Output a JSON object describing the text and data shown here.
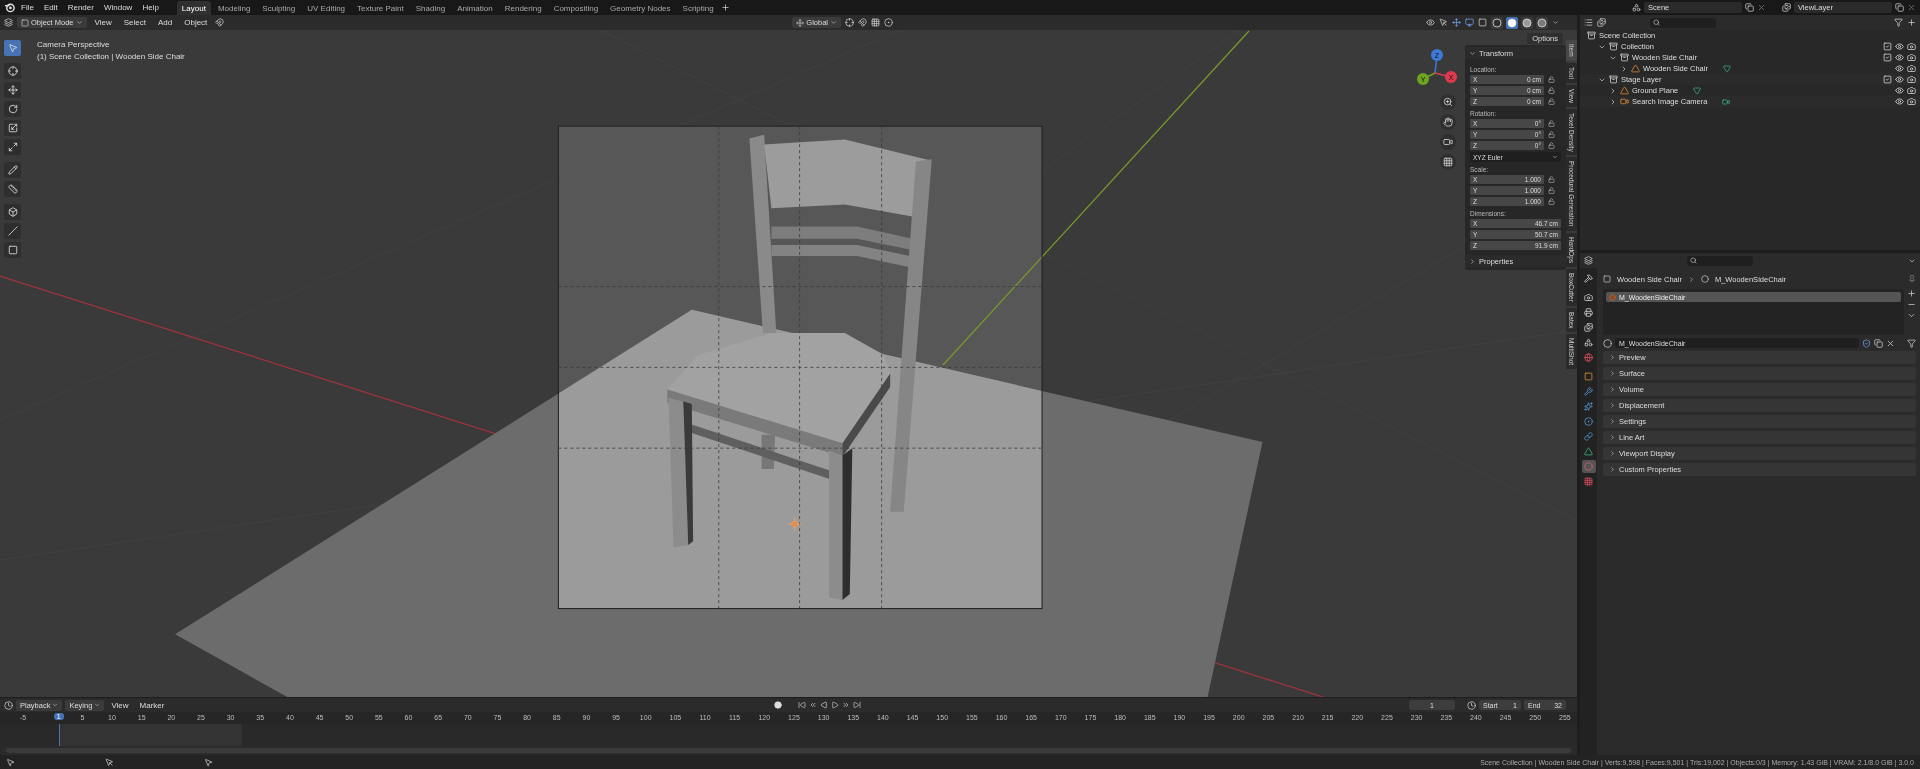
{
  "top_bar": {
    "menus": [
      "File",
      "Edit",
      "Render",
      "Window",
      "Help"
    ],
    "workspaces": [
      {
        "label": "Layout",
        "selected": true
      },
      {
        "label": "Modeling",
        "selected": false
      },
      {
        "label": "Sculpting",
        "selected": false
      },
      {
        "label": "UV Editing",
        "selected": false
      },
      {
        "label": "Texture Paint",
        "selected": false
      },
      {
        "label": "Shading",
        "selected": false
      },
      {
        "label": "Animation",
        "selected": false
      },
      {
        "label": "Rendering",
        "selected": false
      },
      {
        "label": "Compositing",
        "selected": false
      },
      {
        "label": "Geometry Nodes",
        "selected": false
      },
      {
        "label": "Scripting",
        "selected": false
      }
    ],
    "scene": "Scene",
    "view_layer": "ViewLayer"
  },
  "viewport": {
    "mode": "Object Mode",
    "menus": [
      "View",
      "Select",
      "Add",
      "Object"
    ],
    "orientation": "Global",
    "options": "Options",
    "view_name": "Camera Perspective",
    "view_info": "(1) Scene Collection | Wooden Side Chair",
    "tools": [
      {
        "kind": "select",
        "selected": true
      },
      {
        "kind": "cursor",
        "selected": false
      },
      {
        "kind": "move",
        "selected": false
      },
      {
        "kind": "rotate",
        "selected": false
      },
      {
        "kind": "scale",
        "selected": false
      },
      {
        "kind": "transform",
        "selected": false
      },
      {
        "kind": "annotate",
        "selected": false
      },
      {
        "kind": "measure",
        "selected": false
      },
      {
        "kind": "add-cube",
        "selected": false
      },
      {
        "kind": "shear",
        "selected": false
      },
      {
        "kind": "cage",
        "selected": false
      }
    ],
    "gizmo_axes": [
      {
        "label": "Z",
        "color": "#3c7ad6"
      },
      {
        "label": "Y",
        "color": "#6ea51f"
      },
      {
        "label": "X",
        "color": "#e0394f"
      }
    ],
    "shading_modes": [
      {
        "kind": "wireframe",
        "selected": false
      },
      {
        "kind": "solid",
        "selected": true
      },
      {
        "kind": "material",
        "selected": false
      },
      {
        "kind": "rendered",
        "selected": false
      }
    ]
  },
  "sidebar": {
    "tabs": [
      {
        "label": "Item",
        "selected": true
      },
      {
        "label": "Tool",
        "selected": false
      },
      {
        "label": "View",
        "selected": false
      },
      {
        "label": "Texel Density",
        "selected": false
      },
      {
        "label": "Procedural Generation",
        "selected": false
      },
      {
        "label": "HardOps",
        "selected": false
      },
      {
        "label": "BoxCutter",
        "selected": false
      },
      {
        "label": "Batex",
        "selected": false
      },
      {
        "label": "MultiShot",
        "selected": false
      }
    ],
    "transform": {
      "title": "Transform",
      "expanded": true,
      "groups": [
        {
          "kind": "vector",
          "label": "Location:",
          "locks": true,
          "fields": [
            {
              "axis": "X",
              "value": "0 cm"
            },
            {
              "axis": "Y",
              "value": "0 cm"
            },
            {
              "axis": "Z",
              "value": "0 cm"
            }
          ]
        },
        {
          "kind": "vector",
          "label": "Rotation:",
          "locks": true,
          "fields": [
            {
              "axis": "X",
              "value": "0°"
            },
            {
              "axis": "Y",
              "value": "0°"
            },
            {
              "axis": "Z",
              "value": "0°"
            }
          ]
        },
        {
          "kind": "dropdown",
          "value": "XYZ Euler"
        },
        {
          "kind": "vector",
          "label": "Scale:",
          "locks": true,
          "fields": [
            {
              "axis": "X",
              "value": "1.000"
            },
            {
              "axis": "Y",
              "value": "1.000"
            },
            {
              "axis": "Z",
              "value": "1.000"
            }
          ]
        },
        {
          "kind": "vector",
          "label": "Dimensions:",
          "locks": false,
          "fields": [
            {
              "axis": "X",
              "value": "46.7 cm"
            },
            {
              "axis": "Y",
              "value": "50.7 cm"
            },
            {
              "axis": "Z",
              "value": "91.9 cm"
            }
          ]
        }
      ]
    },
    "properties_panel": {
      "title": "Properties",
      "expanded": false
    }
  },
  "outliner": {
    "items": [
      {
        "label": "Scene Collection",
        "kind": "scene-collection",
        "children": [
          {
            "label": "Collection",
            "kind": "collection",
            "expanded": true,
            "children": [
              {
                "label": "Wooden Side Chair",
                "kind": "collection",
                "expanded": true,
                "children": [
                  {
                    "label": "Wooden Side Chair",
                    "kind": "mesh",
                    "data_block": {
                      "kind": "mesh"
                    },
                    "expanded": false
                  }
                ]
              }
            ]
          },
          {
            "label": "Stage Layer",
            "kind": "collection",
            "expanded": true,
            "children": [
              {
                "label": "Ground Plane",
                "kind": "mesh",
                "data_block": {
                  "kind": "mesh"
                },
                "expanded": false
              },
              {
                "label": "Search Image Camera",
                "kind": "camera",
                "data_block": {
                  "kind": "camera"
                },
                "expanded": false
              }
            ]
          }
        ]
      }
    ]
  },
  "properties": {
    "tabs": [
      {
        "kind": "tool",
        "selected": false
      },
      {
        "kind": "render",
        "selected": false
      },
      {
        "kind": "output",
        "selected": false
      },
      {
        "kind": "view-layer",
        "selected": false
      },
      {
        "kind": "scene",
        "selected": false
      },
      {
        "kind": "world",
        "selected": false
      },
      {
        "kind": "object",
        "selected": false
      },
      {
        "kind": "modifiers",
        "selected": false
      },
      {
        "kind": "particles",
        "selected": false
      },
      {
        "kind": "physics",
        "selected": false
      },
      {
        "kind": "constraints",
        "selected": false
      },
      {
        "kind": "data",
        "selected": false
      },
      {
        "kind": "material",
        "selected": true
      },
      {
        "kind": "texture",
        "selected": false
      }
    ],
    "breadcrumb": [
      "Wooden Side Chair",
      "M_WoodenSideChair"
    ],
    "slots": [
      {
        "label": "M_WoodenSideChair",
        "selected": true
      }
    ],
    "material": "M_WoodenSideChair",
    "panels": [
      {
        "label": "Preview",
        "expanded": false
      },
      {
        "label": "Surface",
        "expanded": false
      },
      {
        "label": "Volume",
        "expanded": false
      },
      {
        "label": "Displacement",
        "expanded": false
      },
      {
        "label": "Settings",
        "expanded": false
      },
      {
        "label": "Line Art",
        "expanded": false
      },
      {
        "label": "Viewport Display",
        "expanded": false
      },
      {
        "label": "Custom Properties",
        "expanded": false
      }
    ]
  },
  "timeline": {
    "menus": [
      "Playback",
      "Keying",
      "View",
      "Marker"
    ],
    "current_frame": "1",
    "start": {
      "label": "Start",
      "value": "1"
    },
    "end": {
      "label": "End",
      "value": "32"
    },
    "playhead": "1",
    "ticks": [
      "-5",
      "5",
      "10",
      "15",
      "20",
      "25",
      "30",
      "35",
      "40",
      "45",
      "50",
      "55",
      "60",
      "65",
      "70",
      "75",
      "80",
      "85",
      "90",
      "95",
      "100",
      "105",
      "110",
      "115",
      "120",
      "125",
      "130",
      "135",
      "140",
      "145",
      "150",
      "155",
      "160",
      "165",
      "170",
      "175",
      "180",
      "185",
      "190",
      "195",
      "200",
      "205",
      "210",
      "215",
      "220",
      "225",
      "230",
      "235",
      "240",
      "245",
      "250",
      "255"
    ]
  },
  "status_bar": {
    "text": "Scene Collection | Wooden Side Chair | Verts:9,598 | Faces:9,501 | Tris:19,002 | Objects:0/3 | Memory: 1.43 GiB | VRAM: 2.1/8.0 GiB | 3.0.0"
  }
}
